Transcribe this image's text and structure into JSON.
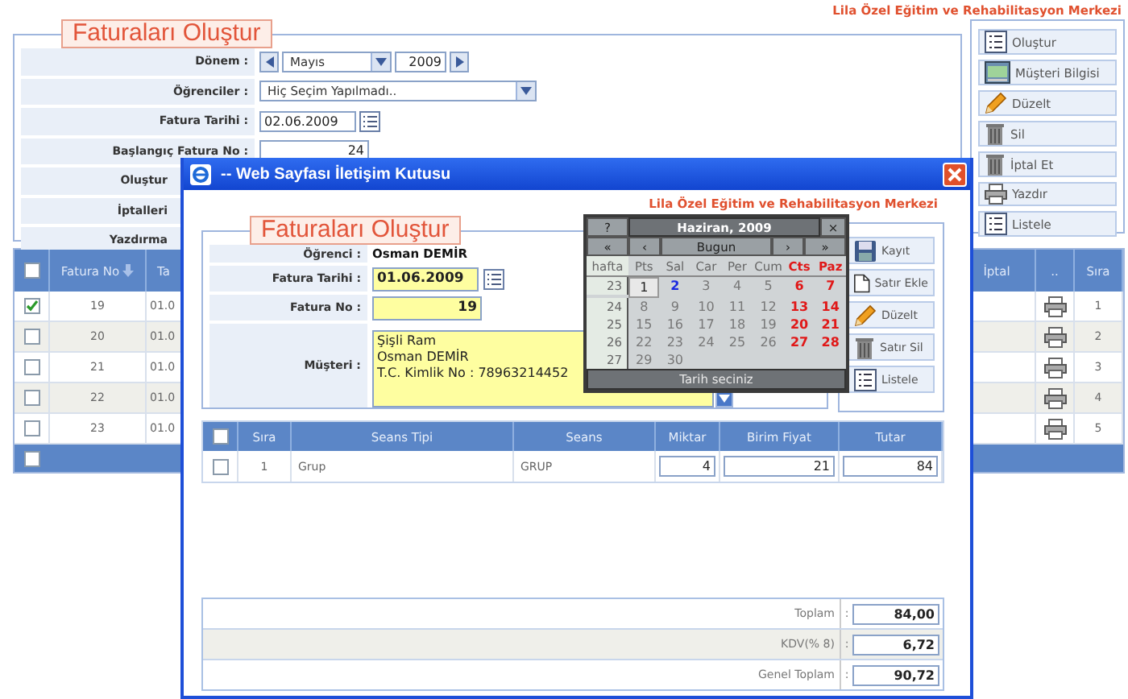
{
  "header": {
    "org": "Lila Özel Eğitim ve Rehabilitasyon Merkezi"
  },
  "form": {
    "legend": "Faturaları Oluştur",
    "rows": [
      {
        "label": "Dönem :",
        "kind": "period",
        "month": "Mayıs",
        "year": "2009"
      },
      {
        "label": "Öğrenciler :",
        "kind": "select",
        "value": "Hiç Seçim Yapılmadı.."
      },
      {
        "label": "Fatura Tarihi :",
        "kind": "date",
        "value": "02.06.2009"
      },
      {
        "label": "Başlangıç Fatura No :",
        "kind": "number",
        "value": "24"
      },
      {
        "label": "Oluştur",
        "kind": "covered"
      },
      {
        "label": "İptalleri",
        "kind": "covered"
      },
      {
        "label": "Yazdırma",
        "kind": "covered"
      }
    ]
  },
  "actions": [
    {
      "label": "Oluştur",
      "kind": "list"
    },
    {
      "label": "Müşteri Bilgisi",
      "kind": "card"
    },
    {
      "label": "Düzelt",
      "kind": "pencil"
    },
    {
      "label": "Sil",
      "kind": "trash"
    },
    {
      "label": "İptal Et",
      "kind": "trash"
    },
    {
      "label": "Yazdır",
      "kind": "printer"
    },
    {
      "label": "Listele",
      "kind": "list"
    }
  ],
  "table": {
    "header_checked": false,
    "footer_checked": false,
    "columns": [
      {
        "label": "Fatura No",
        "sorted": true
      },
      {
        "label": "Ta",
        "sorted": false
      },
      {
        "label": "İptal",
        "sorted": false
      },
      {
        "label": "..",
        "sorted": false
      },
      {
        "label": "Sıra",
        "sorted": false
      }
    ],
    "rows": [
      {
        "checked": true,
        "fatura_no": "19",
        "date": "01.0",
        "sira": "1"
      },
      {
        "checked": false,
        "fatura_no": "20",
        "date": "01.0",
        "sira": "2"
      },
      {
        "checked": false,
        "fatura_no": "21",
        "date": "01.0",
        "sira": "3"
      },
      {
        "checked": false,
        "fatura_no": "22",
        "date": "01.0",
        "sira": "4"
      },
      {
        "checked": false,
        "fatura_no": "23",
        "date": "01.0",
        "sira": "5"
      }
    ]
  },
  "dialog": {
    "title": "-- Web Sayfası İletişim Kutusu",
    "org": "Lila Özel Eğitim ve Rehabilitasyon Merkezi",
    "legend": "Faturaları Oluştur",
    "student_label": "Öğrenci :",
    "student": "Osman DEMİR",
    "fields": [
      {
        "label": "Fatura Tarihi :",
        "value": "01.06.2009",
        "kind": "date"
      },
      {
        "label": "Fatura No :",
        "value": "19",
        "kind": "number"
      }
    ],
    "customer_label": "Müşteri :",
    "customer_lines": [
      "Şişli Ram",
      "Osman DEMİR",
      "T.C. Kimlik No : 78963214452"
    ],
    "actions": [
      {
        "label": "Kayıt",
        "kind": "disk"
      },
      {
        "label": "Satır Ekle",
        "kind": "page"
      },
      {
        "label": "Düzelt",
        "kind": "pencil"
      },
      {
        "label": "Satır Sil",
        "kind": "trash"
      },
      {
        "label": "Listele",
        "kind": "list"
      }
    ],
    "table": {
      "header_checked": false,
      "columns": [
        "Sıra",
        "Seans Tipi",
        "Seans",
        "Miktar",
        "Birim Fiyat",
        "Tutar"
      ],
      "rows": [
        {
          "checked": false,
          "sira": "1",
          "seans_tipi": "Grup",
          "seans": "GRUP",
          "miktar": "4",
          "birim_fiyat": "21",
          "tutar": "84"
        }
      ]
    },
    "totals": [
      {
        "label": "Toplam",
        "colon": ":",
        "value": "84,00"
      },
      {
        "label": "KDV(% 8)",
        "colon": ":",
        "value": "6,72"
      },
      {
        "label": "Genel Toplam",
        "colon": ":",
        "value": "90,72"
      }
    ]
  },
  "calendar": {
    "help": "?",
    "title": "Haziran, 2009",
    "close": "×",
    "prev_year": "«",
    "prev_month": "‹",
    "today": "Bugun",
    "next_month": "›",
    "next_year": "»",
    "week_label": "hafta",
    "footer": "Tarih seciniz",
    "weekdays": [
      {
        "label": "Pts",
        "weekend": false
      },
      {
        "label": "Sal",
        "weekend": false
      },
      {
        "label": "Car",
        "weekend": false
      },
      {
        "label": "Per",
        "weekend": false
      },
      {
        "label": "Cum",
        "weekend": false
      },
      {
        "label": "Cts",
        "weekend": true
      },
      {
        "label": "Paz",
        "weekend": true
      }
    ],
    "weeks": [
      {
        "week": "23",
        "days": [
          {
            "d": "1",
            "selected": true,
            "today": false
          },
          {
            "d": "2",
            "selected": false,
            "today": true
          },
          {
            "d": "3",
            "selected": false,
            "today": false
          },
          {
            "d": "4",
            "selected": false,
            "today": false
          },
          {
            "d": "5",
            "selected": false,
            "today": false
          },
          {
            "d": "6",
            "selected": false,
            "today": false
          },
          {
            "d": "7",
            "selected": false,
            "today": false
          }
        ]
      },
      {
        "week": "24",
        "days": [
          {
            "d": "8",
            "selected": false,
            "today": false
          },
          {
            "d": "9",
            "selected": false,
            "today": false
          },
          {
            "d": "10",
            "selected": false,
            "today": false
          },
          {
            "d": "11",
            "selected": false,
            "today": false
          },
          {
            "d": "12",
            "selected": false,
            "today": false
          },
          {
            "d": "13",
            "selected": false,
            "today": false
          },
          {
            "d": "14",
            "selected": false,
            "today": false
          }
        ]
      },
      {
        "week": "25",
        "days": [
          {
            "d": "15",
            "selected": false,
            "today": false
          },
          {
            "d": "16",
            "selected": false,
            "today": false
          },
          {
            "d": "17",
            "selected": false,
            "today": false
          },
          {
            "d": "18",
            "selected": false,
            "today": false
          },
          {
            "d": "19",
            "selected": false,
            "today": false
          },
          {
            "d": "20",
            "selected": false,
            "today": false
          },
          {
            "d": "21",
            "selected": false,
            "today": false
          }
        ]
      },
      {
        "week": "26",
        "days": [
          {
            "d": "22",
            "selected": false,
            "today": false
          },
          {
            "d": "23",
            "selected": false,
            "today": false
          },
          {
            "d": "24",
            "selected": false,
            "today": false
          },
          {
            "d": "25",
            "selected": false,
            "today": false
          },
          {
            "d": "26",
            "selected": false,
            "today": false
          },
          {
            "d": "27",
            "selected": false,
            "today": false
          },
          {
            "d": "28",
            "selected": false,
            "today": false
          }
        ]
      },
      {
        "week": "27",
        "days": [
          {
            "d": "29",
            "selected": false,
            "today": false
          },
          {
            "d": "30",
            "selected": false,
            "today": false
          }
        ]
      }
    ]
  }
}
